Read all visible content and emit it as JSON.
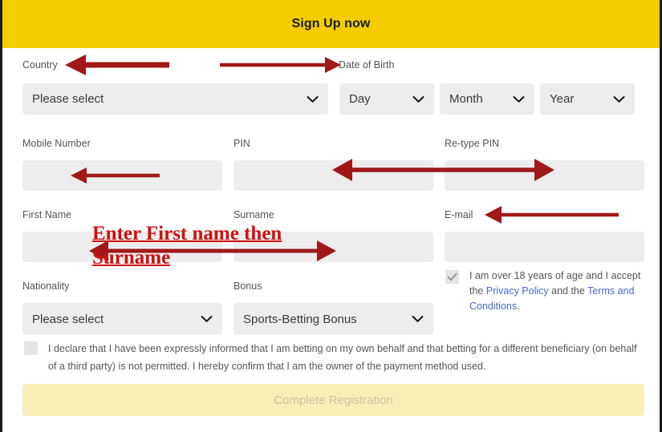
{
  "header": {
    "title": "Sign Up now",
    "bg_color": "#F5CC00"
  },
  "form": {
    "country": {
      "label": "Country",
      "value": "Please select"
    },
    "date_of_birth": {
      "label": "Date of Birth",
      "day": "Day",
      "month": "Month",
      "year": "Year"
    },
    "mobile_number": {
      "label": "Mobile Number",
      "value": ""
    },
    "pin": {
      "label": "PIN",
      "value": ""
    },
    "retype_pin": {
      "label": "Re-type PIN",
      "value": ""
    },
    "first_name": {
      "label": "First Name",
      "value": ""
    },
    "surname": {
      "label": "Surname",
      "value": ""
    },
    "email": {
      "label": "E-mail",
      "value": ""
    },
    "nationality": {
      "label": "Nationality",
      "value": "Please select"
    },
    "bonus": {
      "label": "Bonus",
      "value": "Sports-Betting Bonus"
    }
  },
  "age_terms": {
    "checked": true,
    "text_before": "I am over 18 years of age and I accept the ",
    "link_privacy": "Privacy Policy",
    "text_middle": " and the ",
    "link_terms": "Terms and Conditions",
    "text_after": "."
  },
  "declaration": {
    "checked": false,
    "text": "I declare that I have been expressly informed that I am betting on my own behalf and that betting for a different beneficiary (on behalf of a third party) is not permitted. I hereby confirm that I am the owner of the payment method used."
  },
  "submit": {
    "label": "Complete Registration",
    "enabled": false
  },
  "annotations": {
    "color": "#A01818",
    "note_color": "#CC1111",
    "note_line1": "Enter First name then",
    "note_line2": "Surname",
    "arrows": [
      {
        "name": "country-arrow",
        "direction": "left"
      },
      {
        "name": "date-of-birth-arrow",
        "direction": "right"
      },
      {
        "name": "mobile-number-arrow",
        "direction": "left"
      },
      {
        "name": "pin-retype-pin-arrow",
        "direction": "both"
      },
      {
        "name": "email-arrow",
        "direction": "left"
      },
      {
        "name": "first-name-surname-arrow",
        "direction": "both"
      }
    ]
  }
}
